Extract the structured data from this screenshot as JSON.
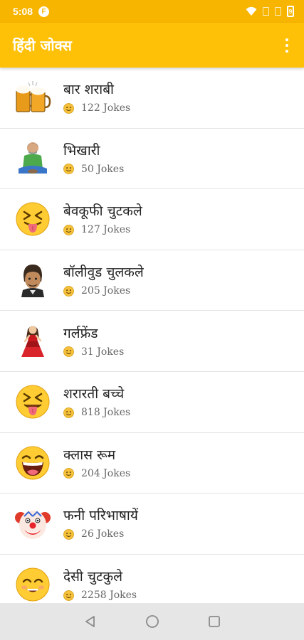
{
  "status_bar": {
    "time": "5:08",
    "app_icon_letter": "F",
    "battery_level": "9"
  },
  "app_bar": {
    "title": "हिंदी जोक्स",
    "overflow_icon": "more-vert-icon"
  },
  "categories": [
    {
      "title": "बार शराबी",
      "count": "122 Jokes",
      "icon": "beer-mugs-icon"
    },
    {
      "title": "भिखारी",
      "count": "50 Jokes",
      "icon": "beggar-icon"
    },
    {
      "title": "बेवकूफी चुटकले",
      "count": "127 Jokes",
      "icon": "tongue-out-face-icon"
    },
    {
      "title": "बॉलीवुड चुलकले",
      "count": "205 Jokes",
      "icon": "bollywood-man-icon"
    },
    {
      "title": "गर्लफ्रेंड",
      "count": "31 Jokes",
      "icon": "girl-red-dress-icon"
    },
    {
      "title": "शरारती बच्चे",
      "count": "818 Jokes",
      "icon": "naughty-face-icon"
    },
    {
      "title": "क्लास रूम",
      "count": "204 Jokes",
      "icon": "laughing-face-icon"
    },
    {
      "title": "फनी परिभाषायें",
      "count": "26 Jokes",
      "icon": "clown-face-icon"
    },
    {
      "title": "देसी चुटकुले",
      "count": "2258 Jokes",
      "icon": "grinning-face-icon"
    }
  ],
  "nav_bar": {
    "back_icon": "back-triangle-icon",
    "home_icon": "home-circle-icon",
    "recents_icon": "recents-square-icon"
  },
  "colors": {
    "status_bar": "#f7b500",
    "app_bar": "#ffc107",
    "nav_bar": "#e6e6e6",
    "emoji_yellow": "#ffcc33"
  }
}
